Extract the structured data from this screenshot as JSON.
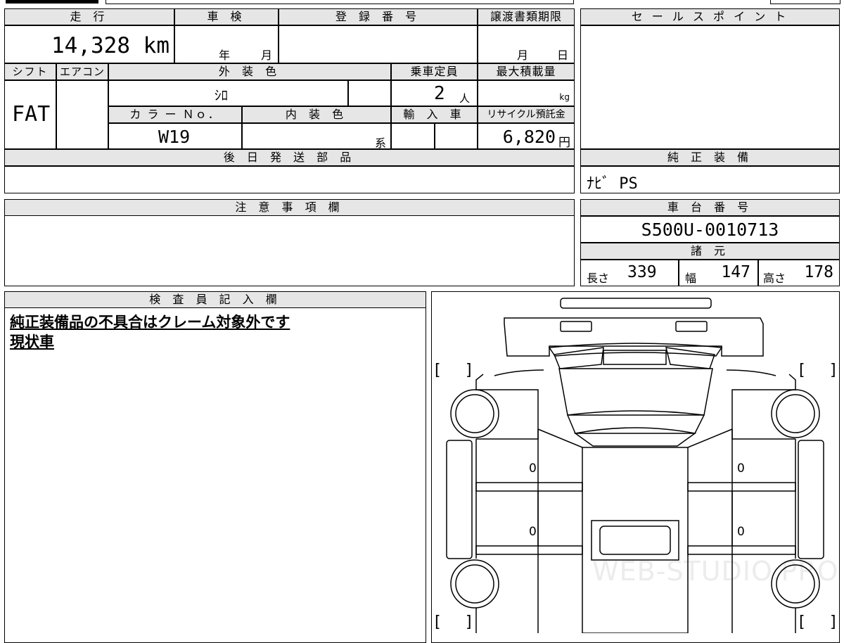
{
  "top_tabs": [
    "",
    "",
    "",
    "",
    "",
    ""
  ],
  "mileage": {
    "label": "走 行",
    "value": "14,328 km"
  },
  "inspection": {
    "label": "車 検",
    "year_suffix": "年",
    "month_suffix": "月"
  },
  "registration": {
    "label": "登 録 番 号",
    "value": ""
  },
  "transfer_deadline": {
    "label": "譲渡書類期限",
    "month_suffix": "月",
    "day_suffix": "日"
  },
  "shift": {
    "label": "シフト",
    "value": "FAT"
  },
  "aircon": {
    "label": "エアコン",
    "value": ""
  },
  "exterior_color": {
    "label": "外 装 色",
    "value": "ｼﾛ"
  },
  "capacity": {
    "label": "乗車定員",
    "value": "2",
    "unit": "人"
  },
  "max_load": {
    "label": "最大積載量",
    "value": "",
    "unit": "kg"
  },
  "color_no": {
    "label": "カ ラ ー Ｎｏ．",
    "value": "W19"
  },
  "interior_color": {
    "label": "内 装 色",
    "value": "",
    "unit": "系"
  },
  "import": {
    "label": "輸 入 車",
    "value": ""
  },
  "recycle": {
    "label": "リサイクル預託金",
    "value": "6,820",
    "unit": "円"
  },
  "later_parts": {
    "label": "後 日 発 送 部 品",
    "value": ""
  },
  "sales_point": {
    "label": "セ ー ル ス ポ イ ン ト",
    "value": ""
  },
  "genuine_equipment": {
    "label": "純 正 装 備",
    "value": "ﾅﾋﾞ PS"
  },
  "notes": {
    "label": "注 意 事 項 欄",
    "value": ""
  },
  "chassis_no": {
    "label": "車 台 番 号",
    "value": "S500U-0010713"
  },
  "specs": {
    "label": "諸 元",
    "length_label": "長さ",
    "length": "339",
    "width_label": "幅",
    "width": "147",
    "height_label": "高さ",
    "height": "178"
  },
  "inspector": {
    "label": "検 査 員 記 入 欄",
    "line1": "純正装備品の不具合はクレーム対象外です",
    "line2": "現状車"
  },
  "diagram": {
    "bracket_open": "[",
    "bracket_close": "]",
    "marks": [
      "0",
      "0",
      "0",
      "0"
    ],
    "watermark": "WEB-STUDIO.PRO"
  }
}
